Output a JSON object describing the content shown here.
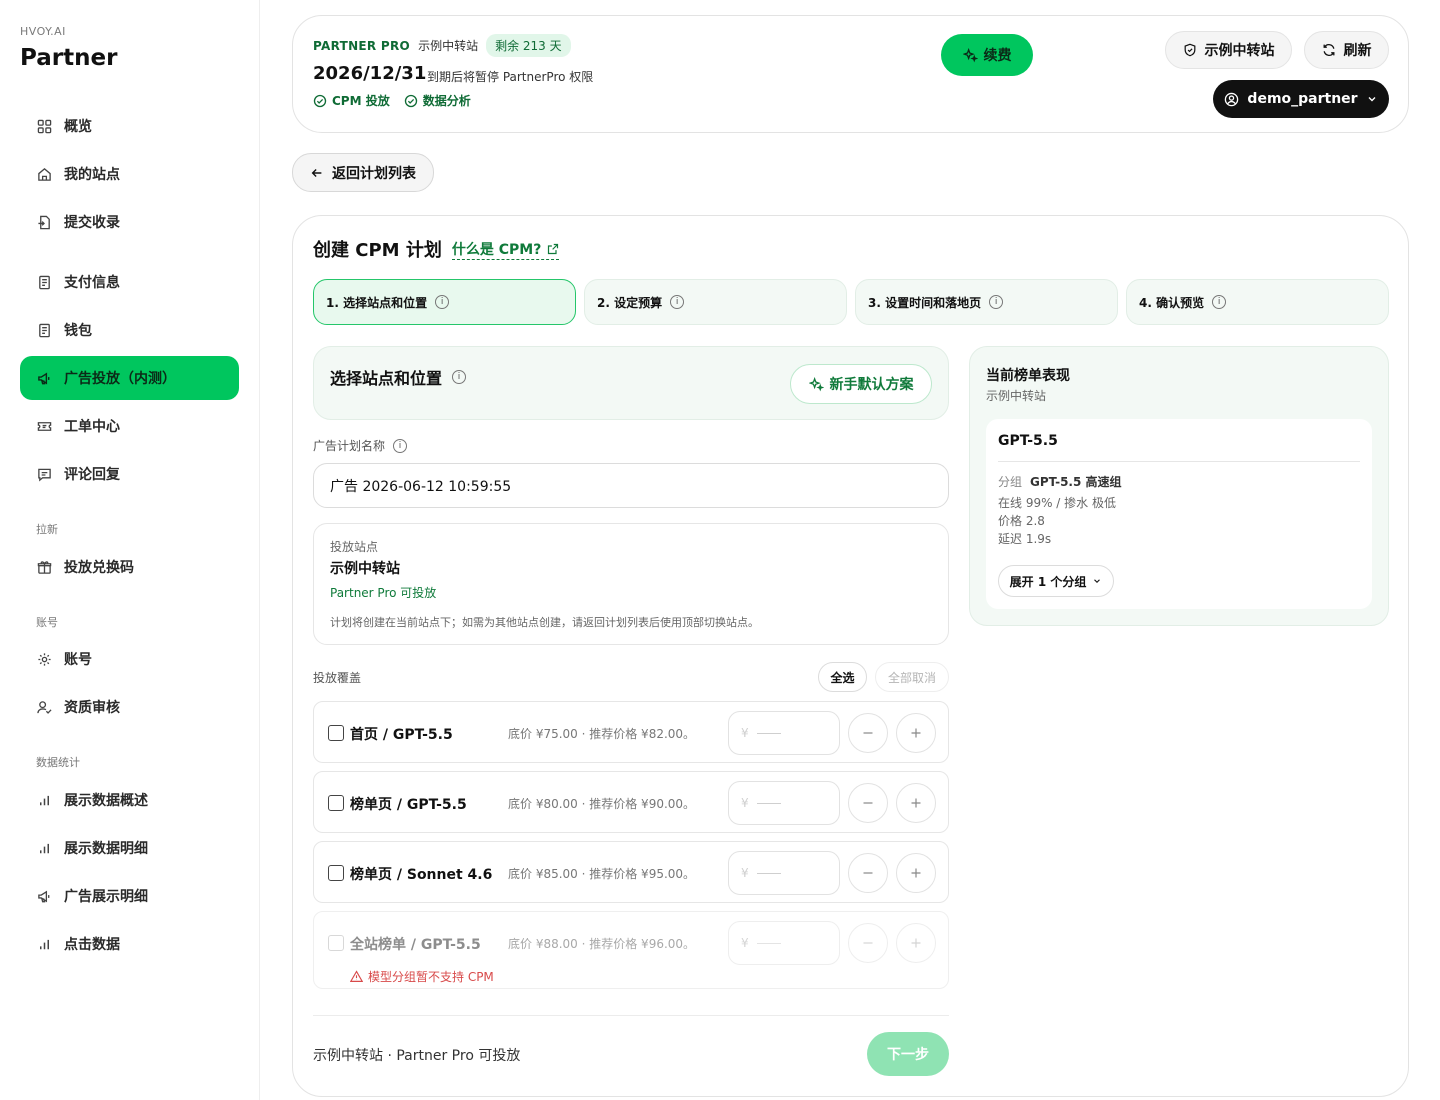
{
  "brand": {
    "small": "HVOY.AI",
    "big": "Partner"
  },
  "sidebar": {
    "items": [
      {
        "label": "概览",
        "icon": "grid-icon"
      },
      {
        "label": "我的站点",
        "icon": "home-icon"
      },
      {
        "label": "提交收录",
        "icon": "file-import-icon"
      },
      {
        "label": "支付信息",
        "icon": "document-icon"
      },
      {
        "label": "钱包",
        "icon": "document-icon"
      },
      {
        "label": "广告投放（内测）",
        "icon": "megaphone-icon",
        "active": true
      },
      {
        "label": "工单中心",
        "icon": "ticket-icon"
      },
      {
        "label": "评论回复",
        "icon": "message-icon"
      }
    ],
    "sections": [
      {
        "title": "拉新",
        "items": [
          {
            "label": "投放兑换码",
            "icon": "gift-icon"
          }
        ]
      },
      {
        "title": "账号",
        "items": [
          {
            "label": "账号",
            "icon": "gear-icon"
          },
          {
            "label": "资质审核",
            "icon": "user-check-icon"
          }
        ]
      },
      {
        "title": "数据统计",
        "items": [
          {
            "label": "展示数据概述",
            "icon": "bar-chart-icon"
          },
          {
            "label": "展示数据明细",
            "icon": "bar-chart-icon"
          },
          {
            "label": "广告展示明细",
            "icon": "megaphone-icon"
          },
          {
            "label": "点击数据",
            "icon": "bar-chart-icon"
          }
        ]
      }
    ]
  },
  "topbar": {
    "plan_name": "PARTNER PRO",
    "site": "示例中转站",
    "remaining": "剩余 213 天",
    "expire_date": "2026/12/31",
    "expire_note": "到期后将暂停 PartnerPro 权限",
    "features": [
      "CPM 投放",
      "数据分析"
    ],
    "renew_label": "续费",
    "site_button": "示例中转站",
    "refresh_button": "刷新",
    "user": "demo_partner"
  },
  "back_label": "返回计划列表",
  "main": {
    "title": "创建 CPM 计划",
    "cpm_link": "什么是 CPM?",
    "steps": [
      {
        "label": "1. 选择站点和位置",
        "active": true
      },
      {
        "label": "2. 设定预算",
        "active": false
      },
      {
        "label": "3. 设置时间和落地页",
        "active": false
      },
      {
        "label": "4. 确认预览",
        "active": false
      }
    ],
    "section_title": "选择站点和位置",
    "default_plan_label": "新手默认方案",
    "name_label": "广告计划名称",
    "name_value": "广告 2026-06-12 10:59:55",
    "site_box": {
      "label": "投放站点",
      "site": "示例中转站",
      "status": "Partner Pro 可投放",
      "note": "计划将创建在当前站点下；如需为其他站点创建，请返回计划列表后使用顶部切换站点。"
    },
    "coverage_label": "投放覆盖",
    "select_all": "全选",
    "deselect_all": "全部取消",
    "slots": [
      {
        "name": "首页 / GPT-5.5",
        "price": "底价 ¥75.00 · 推荐价格 ¥82.00。",
        "disabled": false
      },
      {
        "name": "榜单页 / GPT-5.5",
        "price": "底价 ¥80.00 · 推荐价格 ¥90.00。",
        "disabled": false
      },
      {
        "name": "榜单页 / Sonnet 4.6",
        "price": "底价 ¥85.00 · 推荐价格 ¥95.00。",
        "disabled": false
      },
      {
        "name": "全站榜单 / GPT-5.5",
        "price": "底价 ¥88.00 · 推荐价格 ¥96.00。",
        "disabled": true,
        "warning": "模型分组暂不支持 CPM"
      }
    ],
    "currency_symbol": "¥",
    "footer_text": "示例中转站 · Partner Pro 可投放",
    "next_label": "下一步"
  },
  "rank": {
    "title": "当前榜单表现",
    "site": "示例中转站",
    "model": "GPT-5.5",
    "group_label": "分组",
    "group_value": "GPT-5.5 高速组",
    "online": "在线 99% / 掺水 极低",
    "price": "价格 2.8",
    "latency": "延迟 1.9s",
    "expand_label": "展开 1 个分组"
  },
  "colors": {
    "accent": "#00c65e",
    "accent_dark": "#0f6b35",
    "warning": "#d84a4a"
  }
}
